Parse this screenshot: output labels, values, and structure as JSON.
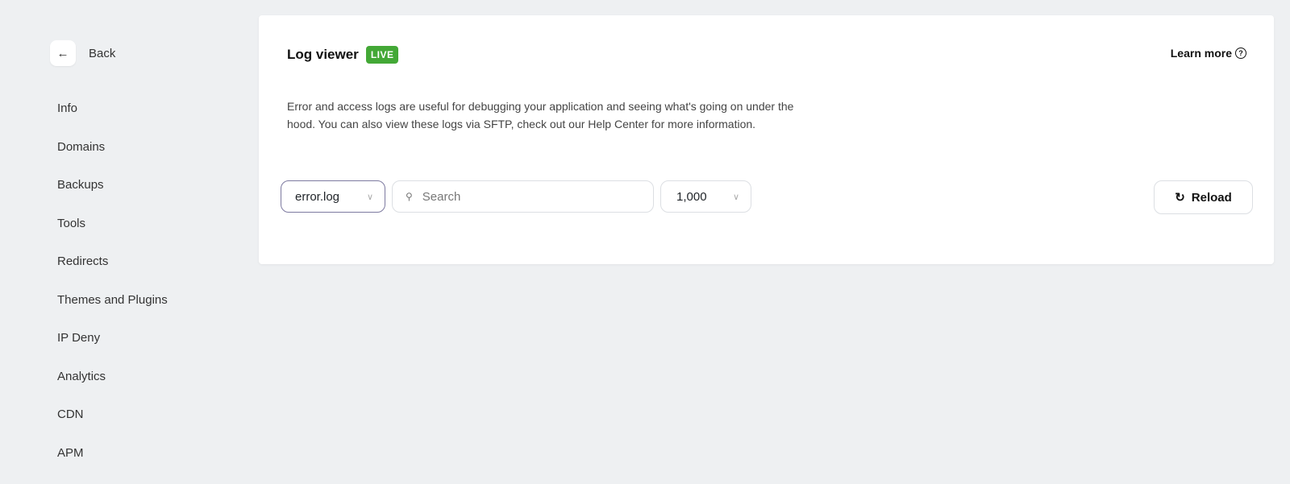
{
  "sidebar": {
    "back_label": "Back",
    "items": [
      {
        "label": "Info"
      },
      {
        "label": "Domains"
      },
      {
        "label": "Backups"
      },
      {
        "label": "Tools"
      },
      {
        "label": "Redirects"
      },
      {
        "label": "Themes and Plugins"
      },
      {
        "label": "IP Deny"
      },
      {
        "label": "Analytics"
      },
      {
        "label": "CDN"
      },
      {
        "label": "APM"
      }
    ]
  },
  "main": {
    "title": "Log viewer",
    "badge": "LIVE",
    "learn_more": "Learn more",
    "description": "Error and access logs are useful for debugging your application and seeing what's going on under the hood. You can also view these logs via SFTP, check out our Help Center for more information.",
    "log_select": "error.log",
    "search_placeholder": "Search",
    "lines_select": "1,000",
    "reload_label": "Reload"
  },
  "colors": {
    "badge": "#43a836",
    "background": "#eef0f2"
  }
}
